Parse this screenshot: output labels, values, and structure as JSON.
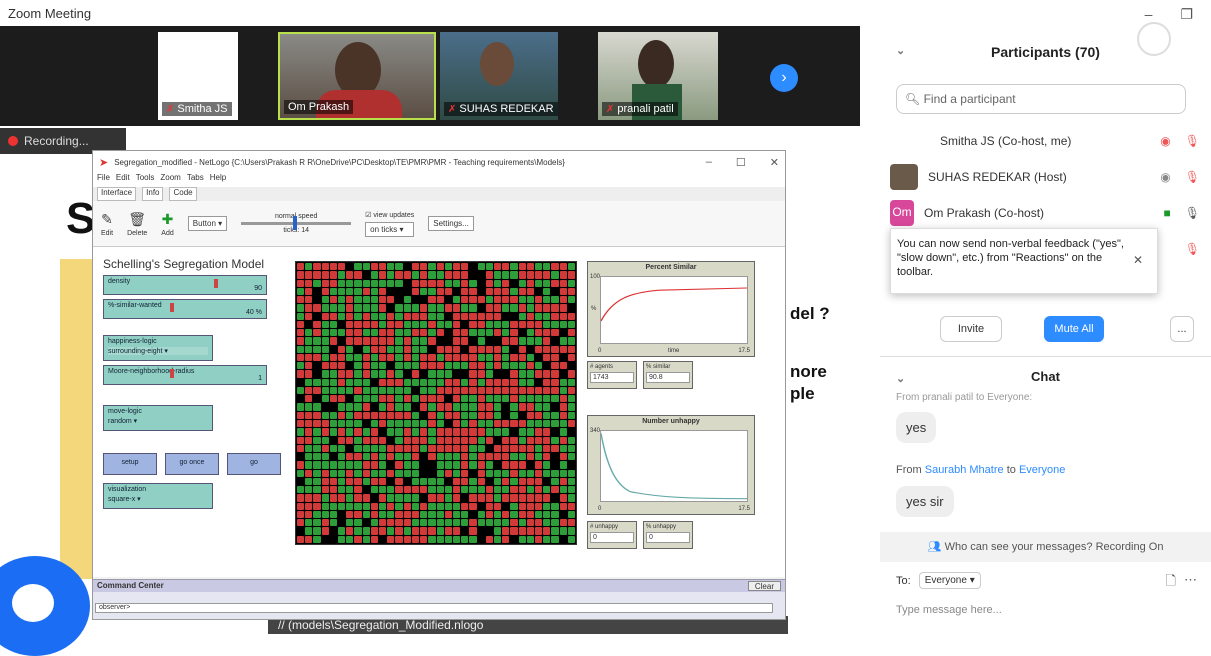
{
  "app_title": "Zoom Meeting",
  "gallery": {
    "tiles": [
      {
        "name": "Smitha JS",
        "muted": true
      },
      {
        "name": "Om Prakash",
        "muted": false
      },
      {
        "name": "SUHAS REDEKAR",
        "muted": true
      },
      {
        "name": "pranali patil",
        "muted": true
      }
    ],
    "next_icon": "chevron-right-icon"
  },
  "recording": {
    "label": "Recording..."
  },
  "slide": {
    "big_letter": "Sc",
    "line1": "del ?",
    "line2": "nore",
    "line3": "ple",
    "url_text": "// (models\\Segregation_Modified.nlogo"
  },
  "netlogo": {
    "window_title": "Segregation_modified - NetLogo {C:\\Users\\Prakash R R\\OneDrive\\PC\\Desktop\\TE\\PMR\\PMR - Teaching requirements\\Models}",
    "menus": [
      "File",
      "Edit",
      "Tools",
      "Zoom",
      "Tabs",
      "Help"
    ],
    "tabs": [
      "Interface",
      "Info",
      "Code"
    ],
    "toolbar": {
      "edit": "Edit",
      "delete": "Delete",
      "add": "Add",
      "widget_type": "Button",
      "speed_label": "normal speed",
      "ticks_label": "ticks: 14",
      "view_updates": "view updates",
      "update_mode": "on ticks",
      "settings": "Settings..."
    },
    "model_title": "Schelling's Segregation Model",
    "widgets": {
      "density": {
        "label": "density",
        "value": "90"
      },
      "similar_wanted": {
        "label": "%-similar-wanted",
        "value": "40 %"
      },
      "happiness_logic": {
        "label": "happiness-logic",
        "value": "surrounding-eight"
      },
      "radius": {
        "label": "Moore-neighborhood-radius",
        "value": "1"
      },
      "move_logic": {
        "label": "move-logic",
        "value": "random"
      },
      "setup": "setup",
      "go_once": "go once",
      "go": "go",
      "visualization": {
        "label": "visualization",
        "value": "square-x"
      }
    },
    "plot1": {
      "title": "Percent Similar",
      "ymax": "100",
      "ylabel": "%",
      "xlabel": "time",
      "xmin": "0",
      "xmax": "17.5"
    },
    "monitors": {
      "agents": {
        "label": "# agents",
        "value": "1743"
      },
      "similar": {
        "label": "% similar",
        "value": "90.8"
      },
      "unhappy": {
        "label": "# unhappy",
        "value": "0"
      },
      "pct_unhappy": {
        "label": "% unhappy",
        "value": "0"
      }
    },
    "plot2": {
      "title": "Number unhappy",
      "ymax": "340",
      "xmin": "0",
      "xmax": "17.5"
    },
    "command_center": "Command Center",
    "clear": "Clear",
    "observer": "observer>"
  },
  "participants": {
    "header": "Participants (70)",
    "search_placeholder": "Find a participant",
    "list": [
      {
        "name": "Smitha JS (Co-host, me)",
        "color": "#ffffff"
      },
      {
        "name": "SUHAS REDEKAR (Host)",
        "color": "#6a5a4a"
      },
      {
        "name": "Om Prakash (Co-host)",
        "color": "#d8489a",
        "initials": "Om"
      }
    ],
    "tooltip": "You can now send non-verbal feedback (\"yes\", \"slow down\", etc.) from \"Reactions\" on the toolbar.",
    "invite": "Invite",
    "mute_all": "Mute All",
    "more": "..."
  },
  "chat": {
    "header": "Chat",
    "partial_line": "From pranali patil to Everyone:",
    "msg1": "yes",
    "from_prefix": "From",
    "from_name": "Saurabh Mhatre",
    "to_word": "to",
    "to_name": "Everyone",
    "msg2": "yes sir",
    "who_can_see": "Who can see your messages? Recording On",
    "to_label": "To:",
    "to_value": "Everyone",
    "input_placeholder": "Type message here..."
  },
  "colors": {
    "zoom_blue": "#2d8cff",
    "netlogo_widget": "#8fcfc4",
    "grid_red": "#d23a3a",
    "grid_green": "#2e9e3a"
  }
}
